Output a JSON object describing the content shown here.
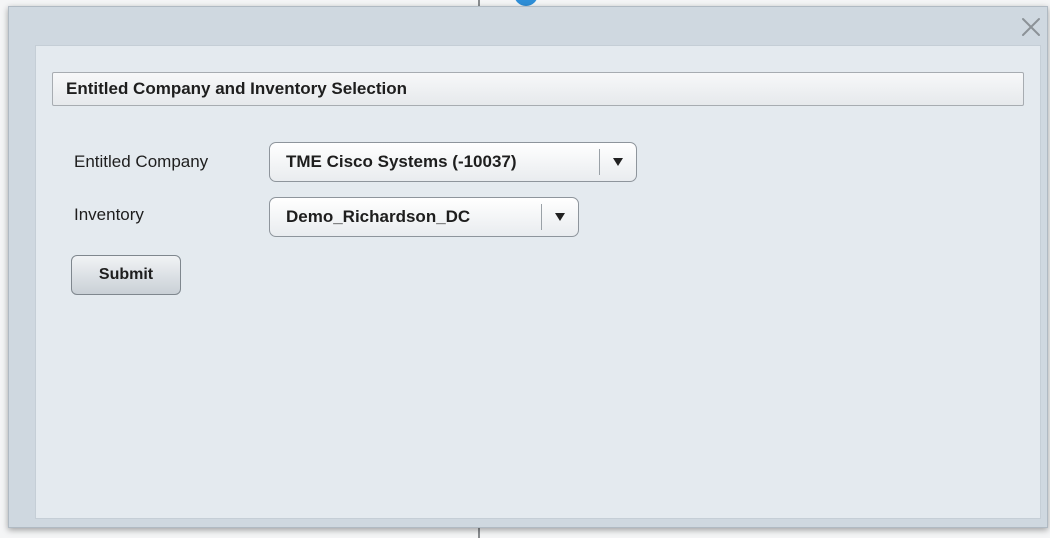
{
  "dialog": {
    "close_icon": "close-icon",
    "section_title": "Entitled Company and Inventory Selection",
    "fields": {
      "company": {
        "label": "Entitled Company",
        "selected": "TME Cisco Systems (-10037)"
      },
      "inventory": {
        "label": "Inventory",
        "selected": "Demo_Richardson_DC"
      }
    },
    "submit_label": "Submit"
  },
  "colors": {
    "dialog_bg": "#cfd8e0",
    "panel_bg": "#e4eaef",
    "accent_badge": "#2f8fd8"
  }
}
